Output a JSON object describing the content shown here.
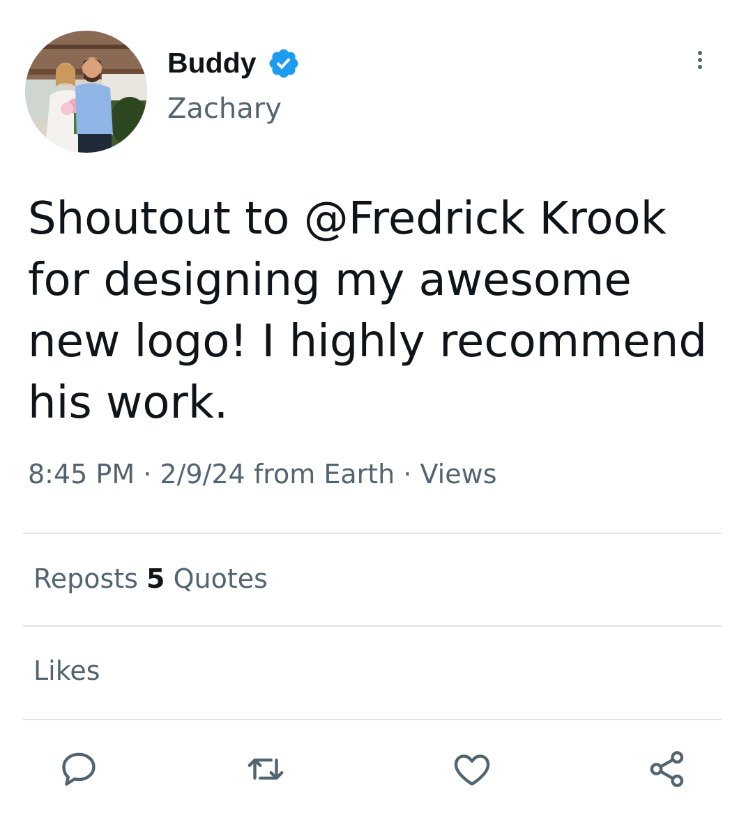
{
  "user": {
    "display_name": "Buddy",
    "handle": "Zachary",
    "verified": true,
    "verified_color": "#1d9bf0"
  },
  "tweet": {
    "text": "Shoutout to @Fredrick Krook for designing my awesome new logo! I highly recommend his work.",
    "time": "8:45 PM",
    "date": "2/9/24",
    "source": "from Earth",
    "views_label": "Views",
    "separator": "·"
  },
  "stats": {
    "reposts_label": "Reposts",
    "quotes_count": "5",
    "quotes_label": "Quotes",
    "likes_label": "Likes"
  },
  "actions": [
    {
      "icon": "reply-icon"
    },
    {
      "icon": "repost-icon"
    },
    {
      "icon": "like-icon"
    },
    {
      "icon": "share-icon"
    }
  ],
  "colors": {
    "text_primary": "#0f1419",
    "text_secondary": "#536471",
    "divider": "#dfe4e8"
  }
}
